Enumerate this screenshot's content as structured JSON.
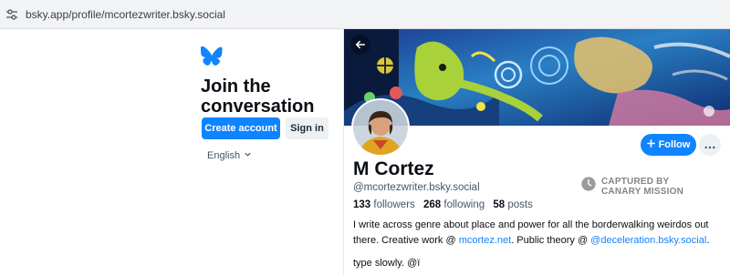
{
  "browser": {
    "url": "bsky.app/profile/mcortezwriter.bsky.social",
    "site_info_icon": "tune-icon"
  },
  "join_panel": {
    "logo_icon": "butterfly-icon",
    "title": "Join the conversation",
    "create_account_label": "Create account",
    "sign_in_label": "Sign in",
    "language": "English",
    "language_icon": "chevron-down-icon"
  },
  "profile": {
    "back_icon": "arrow-left-icon",
    "follow_label": "Follow",
    "follow_icon": "plus-icon",
    "more_icon": "ellipsis-icon",
    "display_name": "M Cortez",
    "handle": "@mcortezwriter.bsky.social",
    "followers_count": "133",
    "followers_label": "followers",
    "following_count": "268",
    "following_label": "following",
    "posts_count": "58",
    "posts_label": "posts",
    "bio_part1": "I write across genre about place and power for all the borderwalking weirdos out there. Creative work @ ",
    "bio_link1": "mcortez.net",
    "bio_part2": ". Public theory @ ",
    "bio_link2": "@deceleration.bsky.social",
    "bio_part3": ".",
    "bio_line2": "type slowly. @ï"
  },
  "watermark": {
    "line1": "CAPTURED BY",
    "line2": "CANARY MISSION",
    "icon": "clock-icon"
  },
  "colors": {
    "accent": "#1083fe",
    "muted": "#42576c",
    "button_secondary": "#eef1f4"
  }
}
